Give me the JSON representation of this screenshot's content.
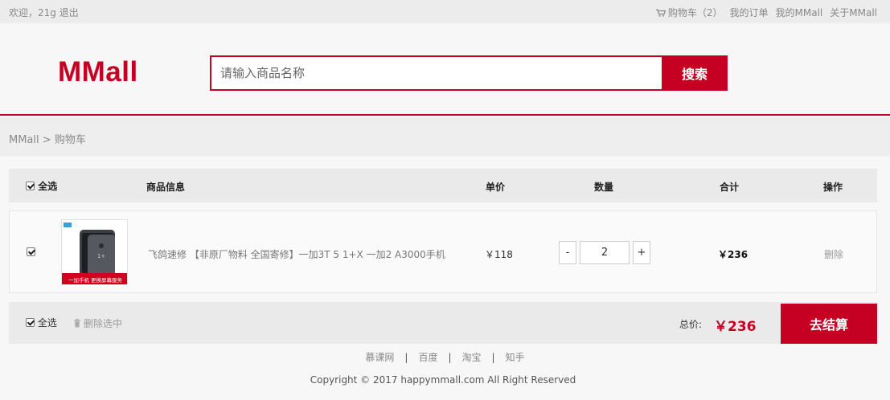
{
  "topnav": {
    "welcome": "欢迎，21g",
    "logout": "退出",
    "cart": "购物车（2）",
    "orders": "我的订单",
    "my_mmall": "我的MMall",
    "about": "关于MMall"
  },
  "header": {
    "logo": "MMall",
    "search_placeholder": "请输入商品名称",
    "search_button": "搜索"
  },
  "breadcrumb": {
    "home": "MMall",
    "separator": ">",
    "current": "购物车"
  },
  "cart_table": {
    "headers": {
      "select_all": "全选",
      "info": "商品信息",
      "unit_price": "单价",
      "quantity": "数量",
      "subtotal": "合计",
      "action": "操作"
    },
    "items": [
      {
        "checked": true,
        "image_text": "一加手机 更换屏幕服务",
        "title": "飞鸽速修 【非原厂物料 全国寄修】一加3T 5 1+X 一加2 A3000手机",
        "price": "￥118",
        "quantity": "2",
        "subtotal": "￥236",
        "delete": "删除"
      }
    ]
  },
  "footer_bar": {
    "select_all": "全选",
    "delete_selected": "删除选中",
    "total_label": "总价:",
    "total_value": "￥236",
    "checkout": "去结算"
  },
  "footer": {
    "links": [
      "慕课网",
      "百度",
      "淘宝",
      "知手"
    ],
    "separator": "|",
    "copyright": "Copyright © 2017 happymmall.com All Right Reserved"
  },
  "colors": {
    "brand": "#c60023"
  }
}
